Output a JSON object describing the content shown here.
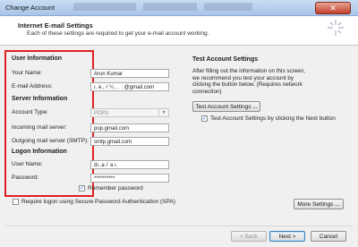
{
  "window": {
    "title": "Change Account",
    "close_glyph": "✕"
  },
  "header": {
    "title": "Internet E-mail Settings",
    "subtitle": "Each of these settings are required to get your e-mail account working."
  },
  "user_info": {
    "heading": "User Information",
    "name_label": "Your Name:",
    "name_value": "Arun Kumar",
    "email_label": "E-mail Address:",
    "email_value": "ı. e.. r ¼ ,  . : @gmail.com"
  },
  "server_info": {
    "heading": "Server Information",
    "account_type_label": "Account Type:",
    "account_type_value": "POP3",
    "incoming_label": "Incoming mail server:",
    "incoming_value": "pop.gmail.com",
    "outgoing_label": "Outgoing mail server (SMTP):",
    "outgoing_value": "smtp.gmail.com"
  },
  "logon_info": {
    "heading": "Logon Information",
    "username_label": "User Name:",
    "username_value": "dı..a  ı' a  ı.",
    "password_label": "Password:",
    "password_value": "**********",
    "remember_label": "Remember password",
    "remember_checked": true,
    "spa_label": "Require logon using Secure Password Authentication (SPA)",
    "spa_checked": false
  },
  "test_settings": {
    "heading": "Test Account Settings",
    "description": "After filling out the information on this screen, we recommend you test your account by clicking the button below. (Requires network connection)",
    "test_button": "Test Account Settings ...",
    "auto_test_label": "Test Account Settings by clicking the Next button",
    "auto_test_checked": true
  },
  "buttons": {
    "more_settings": "More Settings ...",
    "back": "< Back",
    "next": "Next >",
    "cancel": "Cancel"
  },
  "icons": {
    "checkmark": "✓",
    "dropdown": "▼"
  },
  "colors": {
    "highlight_box": "#e02020",
    "titlebar": "#b8cfee",
    "close_button": "#c94a34"
  }
}
